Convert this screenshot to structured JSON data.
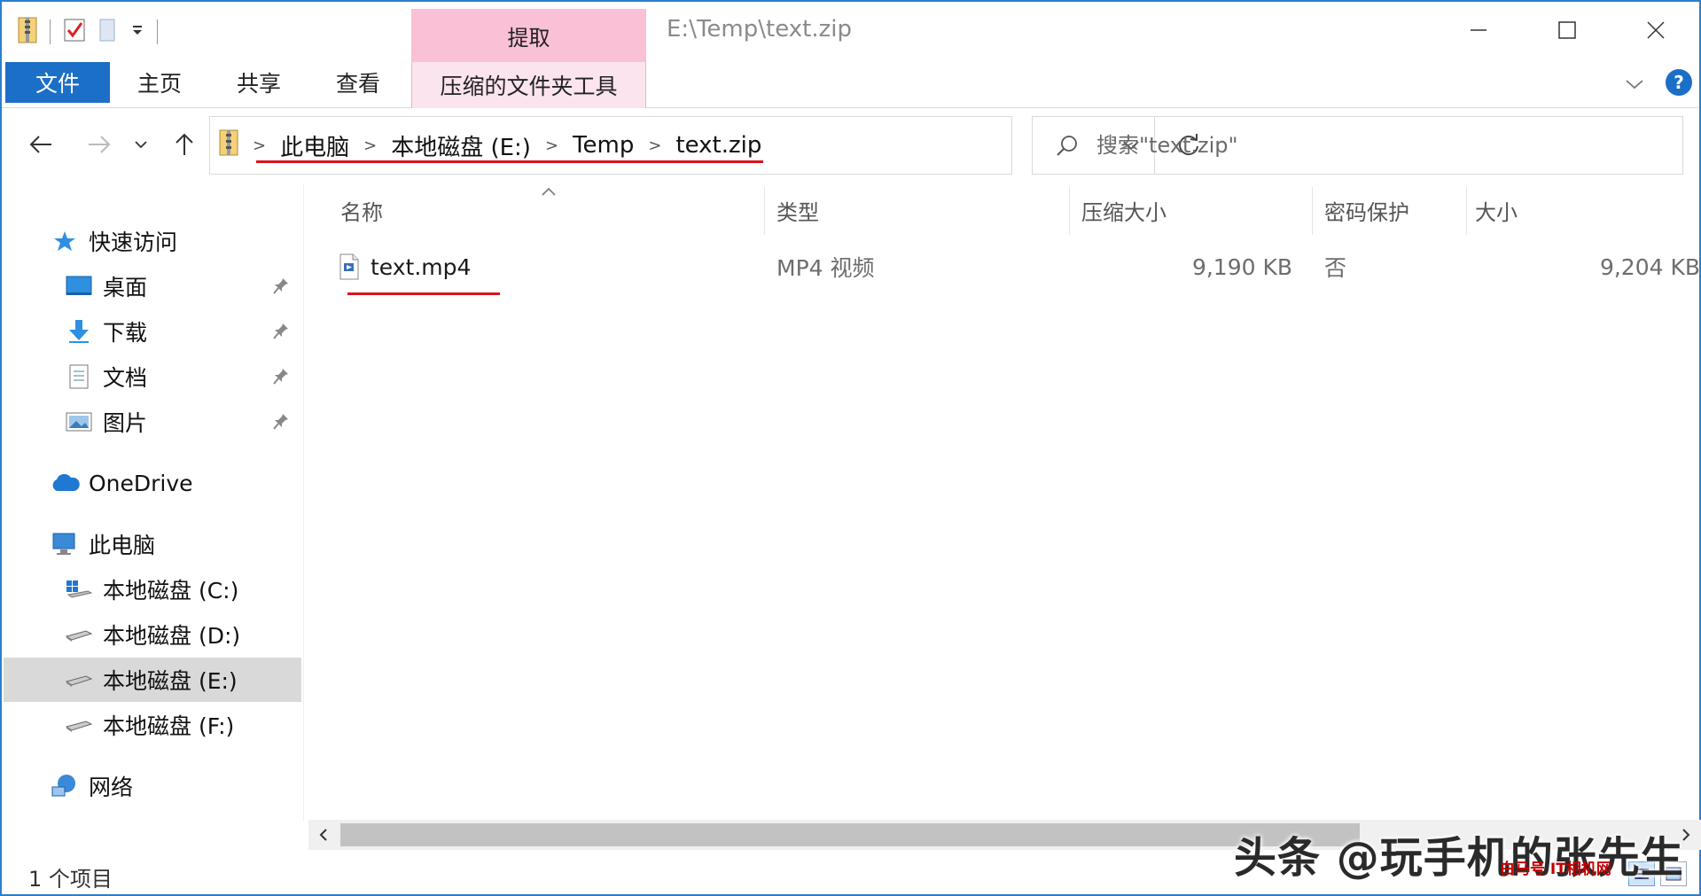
{
  "window": {
    "title": "E:\\Temp\\text.zip",
    "context_tab_group": "提取"
  },
  "ribbon": {
    "tabs": [
      "文件",
      "主页",
      "共享",
      "查看",
      "压缩的文件夹工具"
    ]
  },
  "address": {
    "crumbs": [
      "此电脑",
      "本地磁盘 (E:)",
      "Temp",
      "text.zip"
    ]
  },
  "search": {
    "placeholder": "搜索\"text.zip\""
  },
  "nav": {
    "quick_access": "快速访问",
    "pinned": [
      "桌面",
      "下载",
      "文档",
      "图片"
    ],
    "onedrive": "OneDrive",
    "this_pc": "此电脑",
    "drives": [
      "本地磁盘 (C:)",
      "本地磁盘 (D:)",
      "本地磁盘 (E:)",
      "本地磁盘 (F:)"
    ],
    "network": "网络"
  },
  "columns": {
    "name": "名称",
    "type": "类型",
    "compressed": "压缩大小",
    "password": "密码保护",
    "size": "大小"
  },
  "files": [
    {
      "name": "text.mp4",
      "type": "MP4 视频",
      "compressed_size": "9,190 KB",
      "password": "否",
      "size": "9,204 KB"
    }
  ],
  "status": {
    "count": "1 个项目"
  },
  "watermark": {
    "text": "头条 @玩手机的张先生",
    "badge": "白马号 IT相机网"
  },
  "colors": {
    "accent": "#1c6fc7",
    "context_tab": "#f9c0d6",
    "annotation_red": "#d8141c"
  }
}
